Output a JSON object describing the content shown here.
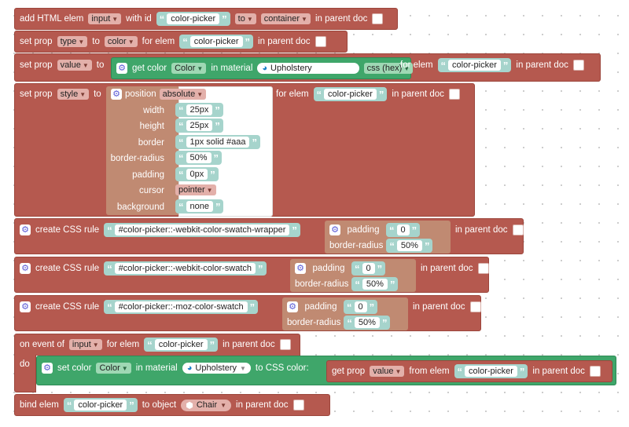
{
  "b1": {
    "add_html_elem": "add HTML elem",
    "type": "input",
    "with_id": "with id",
    "id": "color-picker",
    "to": "to",
    "parent": "container",
    "in_parent_doc": "in parent doc"
  },
  "b2": {
    "set_prop": "set prop",
    "prop": "type",
    "to": "to",
    "value": "color",
    "for_elem": "for elem",
    "elem": "color-picker",
    "in_parent_doc": "in parent doc"
  },
  "b3": {
    "set_prop": "set prop",
    "prop": "value",
    "to": "to",
    "get_color": "get color",
    "color_name": "Color",
    "in_material": "in material",
    "material": "Upholstery",
    "format": "css (hex)",
    "for_elem": "for elem",
    "elem": "color-picker",
    "in_parent_doc": "in parent doc"
  },
  "b4": {
    "set_prop": "set prop",
    "prop": "style",
    "to": "to",
    "for_elem": "for elem",
    "elem": "color-picker",
    "in_parent_doc": "in parent doc",
    "styles": [
      {
        "key": "position",
        "value": "absolute"
      },
      {
        "key": "width",
        "value": "25px"
      },
      {
        "key": "height",
        "value": "25px"
      },
      {
        "key": "border",
        "value": "1px solid #aaa"
      },
      {
        "key": "border-radius",
        "value": "50%"
      },
      {
        "key": "padding",
        "value": "0px"
      },
      {
        "key": "cursor",
        "value": "pointer"
      },
      {
        "key": "background",
        "value": "none"
      }
    ]
  },
  "css_rules": [
    {
      "create": "create CSS rule",
      "selector": "#color-picker::-webkit-color-swatch-wrapper",
      "padding_label": "padding",
      "padding": "0",
      "br_label": "border-radius",
      "br": "50%",
      "in_parent_doc": "in parent doc"
    },
    {
      "create": "create CSS rule",
      "selector": "#color-picker::-webkit-color-swatch",
      "padding_label": "padding",
      "padding": "0",
      "br_label": "border-radius",
      "br": "50%",
      "in_parent_doc": "in parent doc"
    },
    {
      "create": "create CSS rule",
      "selector": "#color-picker::-moz-color-swatch",
      "padding_label": "padding",
      "padding": "0",
      "br_label": "border-radius",
      "br": "50%",
      "in_parent_doc": "in parent doc"
    }
  ],
  "event": {
    "on_event_of": "on event of",
    "event": "input",
    "for_elem": "for elem",
    "elem": "color-picker",
    "in_parent_doc": "in parent doc",
    "do": "do",
    "set_color": "set color",
    "color_name": "Color",
    "in_material": "in material",
    "material": "Upholstery",
    "to_css": "to CSS color:",
    "get_prop": "get prop",
    "prop": "value",
    "from_elem": "from elem",
    "elem2": "color-picker",
    "in_parent_doc2": "in parent doc"
  },
  "bind": {
    "bind_elem": "bind elem",
    "elem": "color-picker",
    "to_object": "to object",
    "object": "Chair",
    "in_parent_doc": "in parent doc"
  }
}
